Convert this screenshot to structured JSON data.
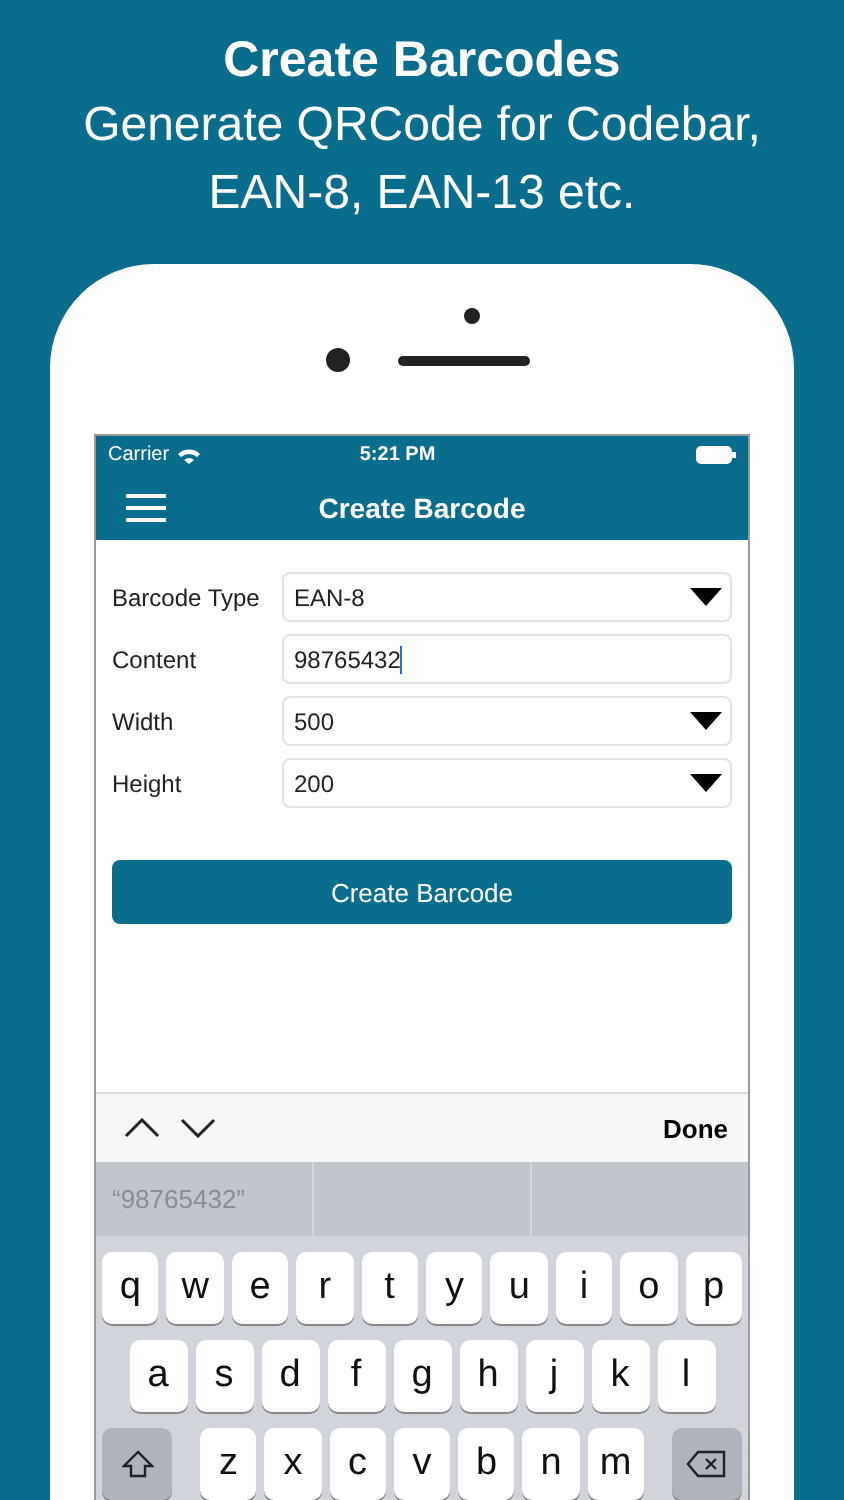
{
  "header": {
    "title": "Create Barcodes",
    "subtitle_lines": [
      "Generate QRCode for Codebar,",
      "EAN-8, EAN-13 etc."
    ]
  },
  "status_bar": {
    "carrier": "Carrier",
    "time": "5:21 PM"
  },
  "nav": {
    "title": "Create Barcode"
  },
  "form": [
    {
      "label": "Barcode Type",
      "value": "EAN-8",
      "kind": "dropdown"
    },
    {
      "label": "Content",
      "value": "98765432",
      "kind": "text",
      "focused": true
    },
    {
      "label": "Width",
      "value": "500",
      "kind": "dropdown"
    },
    {
      "label": "Height",
      "value": "200",
      "kind": "dropdown"
    }
  ],
  "button": "Create Barcode",
  "accessory": {
    "done": "Done"
  },
  "suggestions": [
    "“98765432”"
  ],
  "keyboard": {
    "rows": [
      [
        "q",
        "w",
        "e",
        "r",
        "t",
        "y",
        "u",
        "i",
        "o",
        "p"
      ],
      [
        "a",
        "s",
        "d",
        "f",
        "g",
        "h",
        "j",
        "k",
        "l"
      ],
      [
        "z",
        "x",
        "c",
        "v",
        "b",
        "n",
        "m"
      ]
    ]
  }
}
